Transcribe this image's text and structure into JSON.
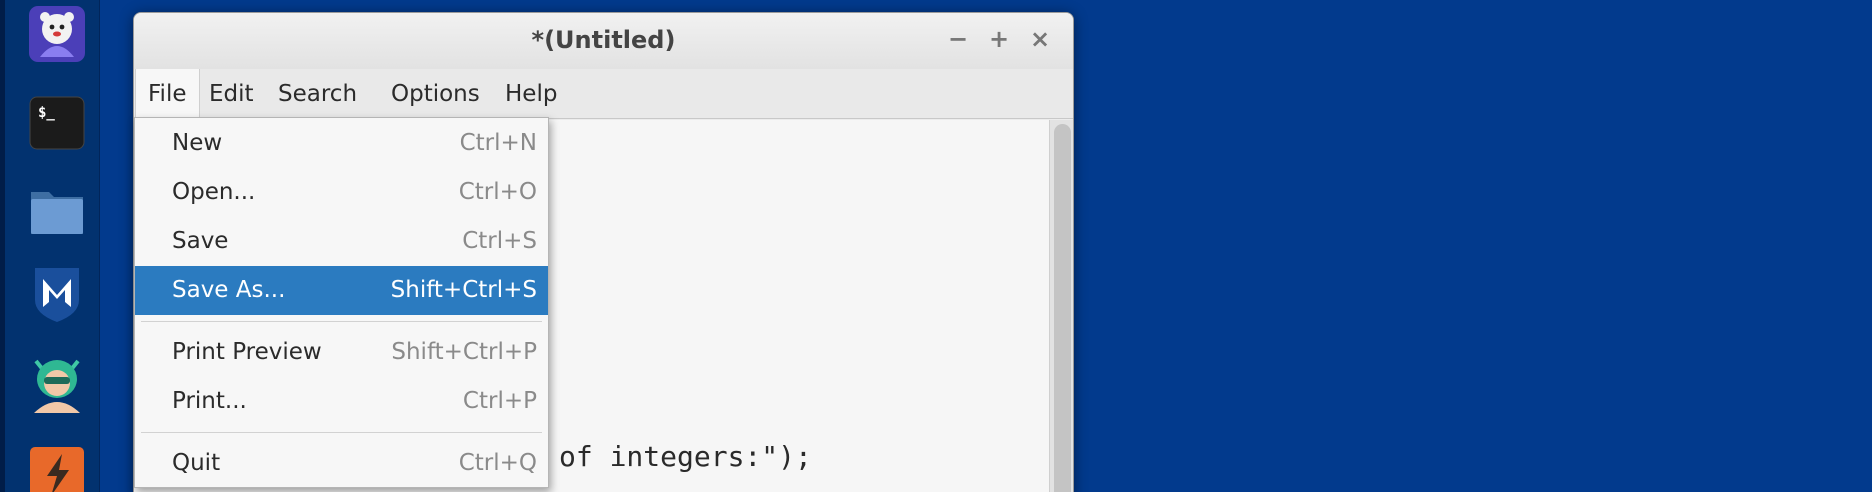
{
  "dock": {
    "items": [
      {
        "icon": "bug-mascot-icon"
      },
      {
        "icon": "terminal-icon",
        "glyph": "$_"
      },
      {
        "icon": "folder-icon"
      },
      {
        "icon": "metasploit-icon",
        "glyph": "M"
      },
      {
        "icon": "anime-character-icon"
      },
      {
        "icon": "burp-suite-icon"
      }
    ]
  },
  "window": {
    "title": "*(Untitled)",
    "controls": {
      "minimize": "−",
      "maximize": "+",
      "close": "×"
    }
  },
  "menubar": {
    "items": [
      "File",
      "Edit",
      "Search",
      "Options",
      "Help"
    ],
    "active": "File"
  },
  "file_menu": {
    "items": [
      {
        "label": "New",
        "accel": "Ctrl+N"
      },
      {
        "label": "Open...",
        "accel": "Ctrl+O"
      },
      {
        "label": "Save",
        "accel": "Ctrl+S"
      },
      {
        "label": "Save As...",
        "accel": "Shift+Ctrl+S",
        "selected": true
      },
      {
        "label": "Print Preview",
        "accel": "Shift+Ctrl+P"
      },
      {
        "label": "Print...",
        "accel": "Ctrl+P"
      },
      {
        "label": "Quit",
        "accel": "Ctrl+Q"
      }
    ]
  },
  "editor": {
    "visible_lines": [
      "of integers:\");"
    ]
  },
  "colors": {
    "desktop": "#023a8d",
    "menu_highlight": "#2b7bc0"
  }
}
